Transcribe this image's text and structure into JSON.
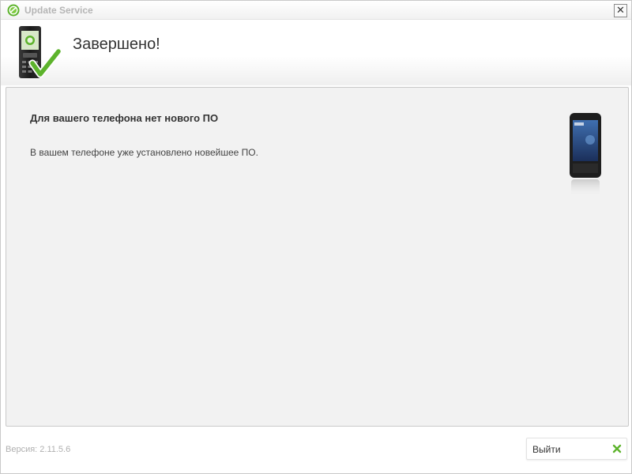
{
  "window": {
    "title": "Update Service",
    "close_glyph": "✕"
  },
  "header": {
    "title": "Завершено!",
    "icon": "phone-checkmark-icon"
  },
  "content": {
    "message_title": "Для вашего телефона нет нового ПО",
    "message_text": "В вашем телефоне уже установлено новейшее ПО.",
    "device_image": "smartphone-icon"
  },
  "footer": {
    "version_text": "Версия: 2.11.5.6",
    "exit_label": "Выйти",
    "exit_icon": "close-icon"
  },
  "colors": {
    "accent_green": "#5db32c",
    "title_gray": "#b5b5b5",
    "panel_bg": "#f2f2f2"
  }
}
